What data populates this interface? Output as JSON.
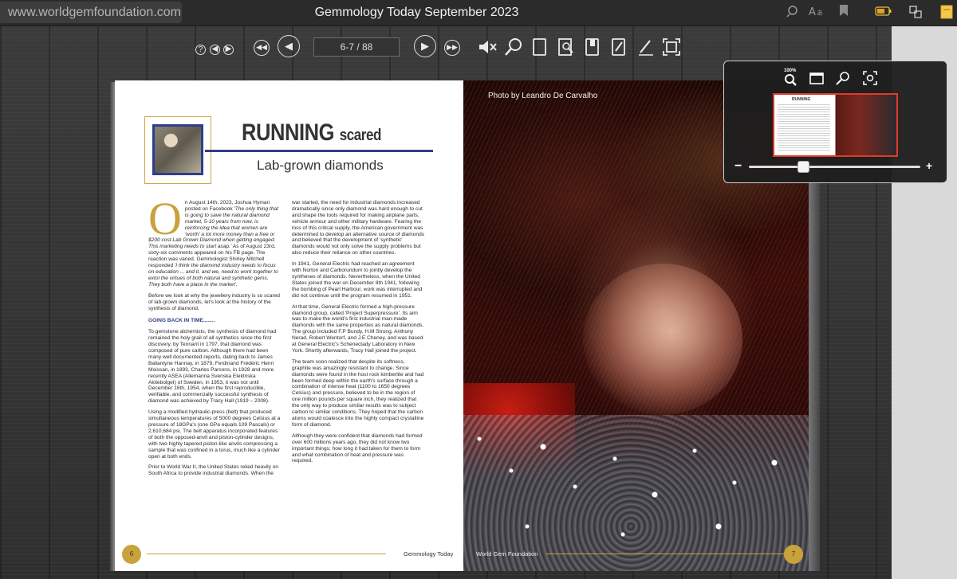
{
  "browser": {
    "url": "www.worldgemfoundation.com",
    "title": "Gemmology Today September 2023"
  },
  "viewer": {
    "page_indicator": "6-7 / 88",
    "zoom_level": "100%"
  },
  "article": {
    "title_main": "RUNNING",
    "title_suffix": "scared",
    "subtitle": "Lab-grown diamonds",
    "dropcap": "O",
    "col1": {
      "p1_normal": "n August 14th, 2023, Joshua Hyman posted on Facebook ",
      "p1_italic": "'The only thing that is going to save the natural diamond market, 5-10 years from now, is reinforcing the idea that women are 'worth' a lot more money than a free or $200 cost Lab Grown Diamond when getting engaged. This marketing needs to start asap.'",
      "p1_cont": " As of August 23rd, sixty-six comments appeared on his FB page. The reaction was varied. Gemmologist Shirley Mitchell responded ",
      "p1_italic2": "'I think the diamond industry needs to focus on education ... and it, and we, need to work together to extol the virtues of both natural and synthetic gems. They both have a place in the market'.",
      "p2": "Before we look at why the jewellery industry is so scared of lab-grown diamonds, let's look at the history of the synthesis of diamond.",
      "section": "GOING BACK IN TIME........",
      "p3": "To gemstone alchemists, the synthesis of diamond had remained the holy grail of all synthetics since the first discovery, by Tennant in 1797, that diamond was composed of pure carbon. Although there had been many well documented reports, dating back to James Ballantyne Hannay, in 1879, Ferdinand Frédéric Henri Moissan, in 1893, Charles Parsons, in 1928 and more recently ASEA (Allemanna Svenska Elektriska Aktiebolget) of Sweden, in 1953, it was not until December 16th, 1954, when the first reproducible, verifiable, and commercially successful synthesis of diamond was achieved by Tracy Hall (1919 – 2008).",
      "p4": "Using a modified hydraulic-press (belt) that produced simultaneous temperatures of 5000 degrees Celsius at a pressure of 18GPa's (one GPa equals 109 Pascals) or 2,610,684 psi. The belt apparatus incorporated features of both the opposed-anvil and piston-cylinder designs, with two highly tapered piston-like anvils compressing a sample that was confined in a torus, much like a cylinder open at both ends.",
      "p5": "Prior to World War II, the United States relied heavily on South Africa to provide industrial diamonds. When the"
    },
    "col2": {
      "p1": "war started, the need for industrial diamonds increased dramatically since only diamond was hard enough to cut and shape the tools required for making airplane parts, vehicle armour and other military hardware. Fearing the loss of this critical supply, the American government was determined to develop an alternative source of diamonds and believed that the development of 'synthetic' diamonds would not only solve the supply problems but also reduce their reliance on other countries.",
      "p2": "In 1941, General Electric had reached an agreement with Norton and Carborundum to jointly develop the syntheses of diamonds. Nevertheless, when the United States joined the war on December 8th 1941, following the bombing of Pearl Harbour, work was interrupted and did not continue until the program resumed in 1951.",
      "p3": "At that time, General Electric formed a high-pressure diamond group, called 'Project Superpressure'. Its aim was to make the world's first industrial man-made diamonds with the same properties as natural diamonds. The group included F.P Bundy, H.M Strong, Anthony Nerad, Robert Wentorf, and J.E Cheney, and was based at General Electric's Schenectady Laboratory in New York. Shortly afterwards, Tracy Hall joined the project.",
      "p4": "The team soon realized that despite its softness, graphite was amazingly resistant to change. Since diamonds were found in the host rock kimberlite and had been formed deep within the earth's surface through a combination of intense heat (1100 to 1650 degrees Celsius) and pressure, believed to be in the region of one million pounds per square inch, they realized that the only way to produce similar results was to subject carbon to similar conditions. They hoped that the carbon atoms would coalesce into the highly compact crystalline form of diamond.",
      "p5": "Although they were confident that diamonds had formed over 600 millions years ago, they did not know two important things; how long it had taken for them to form and what combination of heat and pressure was required."
    },
    "footer_left": "Gemmology Today",
    "page_left": "6",
    "footer_right": "World Gem Foundation",
    "page_right": "7",
    "photo_credit": "Photo by Leandro De Carvalho"
  },
  "zoom_panel": {
    "percent": "100%",
    "minus": "−",
    "plus": "+",
    "thumb_title": "RUNNING",
    "zoom_fraction": 0.32
  },
  "colors": {
    "accent_gold": "#c9a23b",
    "accent_blue": "#2d3f8a",
    "thumb_border": "#e03a2a"
  }
}
